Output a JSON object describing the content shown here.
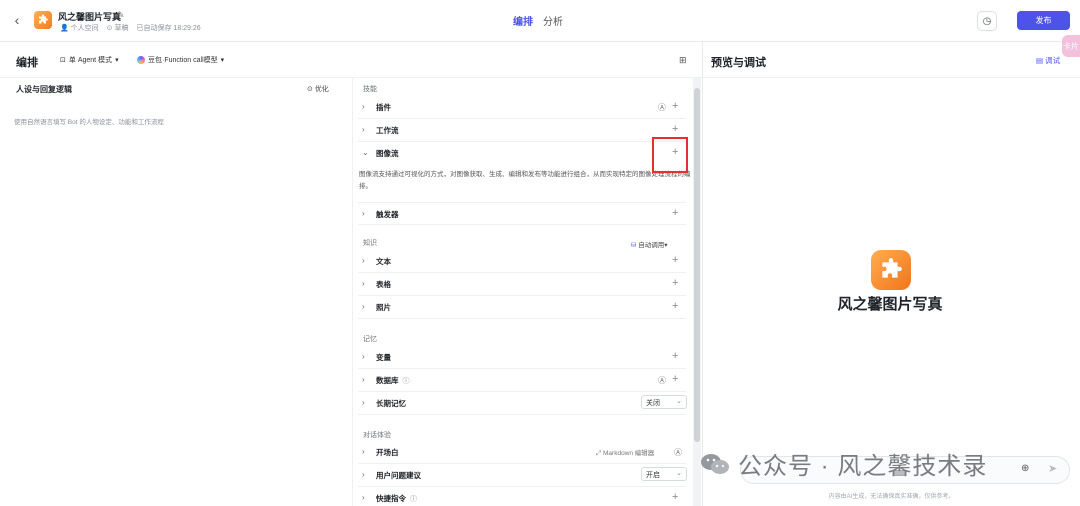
{
  "header": {
    "app_title": "风之馨图片写真",
    "space": "个人空间",
    "status": "草稿",
    "autosave": "已自动保存 18:29:26",
    "tabs": [
      "编排",
      "分析"
    ],
    "publish_label": "发布",
    "side_badge": "卡片"
  },
  "left_header": {
    "title": "编排",
    "agent_mode": "单 Agent 模式",
    "model": "豆包·Function call模型"
  },
  "persona": {
    "title": "人设与回复逻辑",
    "optimize_label": "优化",
    "placeholder": "使用自然语言填写 Bot 的人物设定、功能和工作流程"
  },
  "skills": {
    "section_skills": "技能",
    "plugin": "插件",
    "workflow": "工作流",
    "image_flow": "图像流",
    "image_flow_desc": "图像流支持通过可视化的方式，对图像获取、生成、编辑和发布等功能进行组合，从而实现特定的图像处理流程的编排。",
    "trigger": "触发器",
    "section_knowledge": "知识",
    "auto_call": "自动调用",
    "text": "文本",
    "table": "表格",
    "photo": "照片",
    "section_memory": "记忆",
    "variable": "变量",
    "database": "数据库",
    "long_memory": "长期记忆",
    "long_memory_value": "关闭",
    "section_dialog": "对话体验",
    "opening": "开场白",
    "markdown_editor": "Markdown 编辑器",
    "suggestion": "用户问题建议",
    "suggestion_value": "开启",
    "shortcut": "快捷指令"
  },
  "preview": {
    "title": "预览与调试",
    "debug_label": "调试",
    "bot_name": "风之馨图片写真",
    "footnote": "内容由AI生成，无法确保真实准确，仅供参考。"
  },
  "watermark": "公众号 · 风之馨技术录"
}
